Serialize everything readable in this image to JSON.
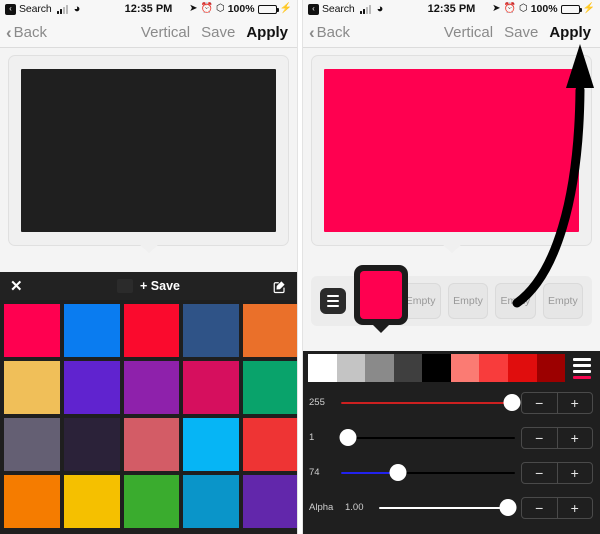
{
  "status_bar": {
    "back_glyph": "‹",
    "carrier": "Search",
    "signal_icon": "signal-bars-icon",
    "wifi_icon": "wifi-icon",
    "time": "12:35 PM",
    "location_icon": "location-arrow-icon",
    "alarm_icon": "alarm-clock-icon",
    "bluetooth_icon": "bluetooth-icon",
    "battery_percent": "100%",
    "battery_icon": "battery-full-icon",
    "charging_icon": "lightning-bolt-icon",
    "battery_color": "#4cd964"
  },
  "nav_bar": {
    "back_chevron": "‹",
    "back_label": "Back",
    "orientation_label": "Vertical",
    "save_label": "Save",
    "apply_label": "Apply"
  },
  "left_panel": {
    "preview": {
      "name": "wallpaper-preview",
      "color": "#1f1f1f"
    },
    "palette_toolbar": {
      "close_icon": "close-x-icon",
      "current_swatch_color": "#2b2b2b",
      "save_label": "+ Save",
      "edit_icon": "edit-pencil-square-icon"
    },
    "swatches": [
      {
        "name": "swatch-crimson",
        "color": "#ff0050"
      },
      {
        "name": "swatch-azure",
        "color": "#0a7cf0"
      },
      {
        "name": "swatch-red",
        "color": "#fa0a2d"
      },
      {
        "name": "swatch-steel-blue",
        "color": "#2f5387"
      },
      {
        "name": "swatch-orange",
        "color": "#ea702a"
      },
      {
        "name": "swatch-sand",
        "color": "#f0bf59"
      },
      {
        "name": "swatch-violet",
        "color": "#6023cf"
      },
      {
        "name": "swatch-purple",
        "color": "#8e21ab"
      },
      {
        "name": "swatch-magenta",
        "color": "#d60f5e"
      },
      {
        "name": "swatch-emerald",
        "color": "#09a36b"
      },
      {
        "name": "swatch-slate",
        "color": "#645f73"
      },
      {
        "name": "swatch-dark-plum",
        "color": "#2b2239"
      },
      {
        "name": "swatch-rose",
        "color": "#d35c66"
      },
      {
        "name": "swatch-cyan",
        "color": "#06b5f5"
      },
      {
        "name": "swatch-tomato",
        "color": "#ee3434"
      },
      {
        "name": "swatch-tangerine",
        "color": "#f57c00"
      },
      {
        "name": "swatch-gold",
        "color": "#f5c000"
      },
      {
        "name": "swatch-green",
        "color": "#3aac2e"
      },
      {
        "name": "swatch-ocean",
        "color": "#0a95c9"
      },
      {
        "name": "swatch-indigo",
        "color": "#6227ab"
      }
    ]
  },
  "right_panel": {
    "preview": {
      "name": "wallpaper-preview",
      "color": "#ff0050"
    },
    "recent_bar": {
      "menu_icon": "hamburger-menu-icon",
      "selected_color": "#ff0050",
      "empty_slots": [
        "Empty",
        "Empty",
        "Empty",
        "Empty"
      ]
    },
    "ramp": {
      "colors": [
        "#ffffff",
        "#c4c4c4",
        "#8a8a8a",
        "#3f3f3f",
        "#000000",
        "#fb7b73",
        "#f83c3c",
        "#e00d0d",
        "#9c0000"
      ],
      "list_icon": "palette-list-icon",
      "list_icon_accent": "#f50a52"
    },
    "sliders": [
      {
        "name": "red-slider",
        "label": "255",
        "value": 255,
        "max": 255,
        "percent": 98,
        "fill_color": "#cc2020"
      },
      {
        "name": "green-slider",
        "label": "1",
        "value": 1,
        "max": 255,
        "percent": 4,
        "fill_color": "#000000"
      },
      {
        "name": "blue-slider",
        "label": "74",
        "value": 74,
        "max": 255,
        "percent": 33,
        "fill_color": "#2222ee"
      },
      {
        "name": "alpha-slider",
        "label": "Alpha",
        "value_text": "1.00",
        "percent": 95,
        "fill_color": "#ffffff"
      }
    ],
    "stepper": {
      "minus_label": "−",
      "plus_label": "+"
    },
    "annotation": {
      "arrow_icon": "curved-arrow-up-icon",
      "points_to": "Apply"
    }
  }
}
